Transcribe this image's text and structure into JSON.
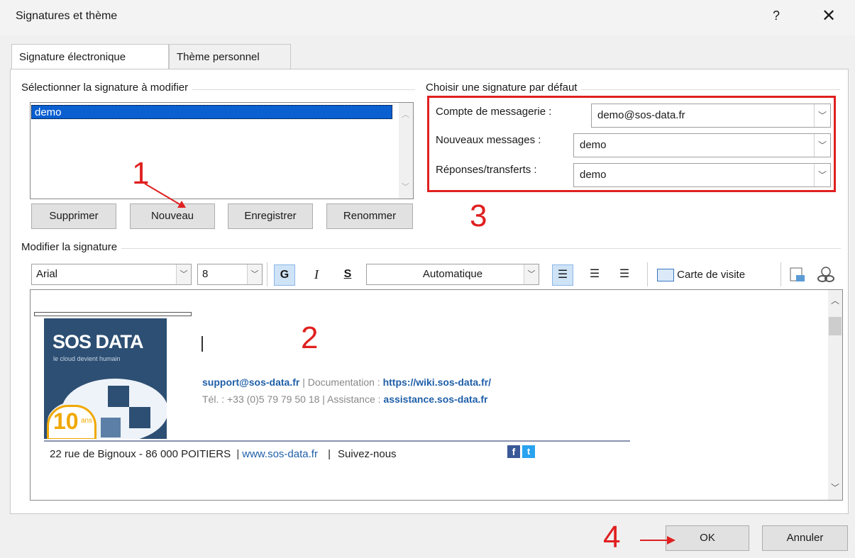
{
  "window": {
    "title": "Signatures et thème",
    "help_label": "?",
    "close_label": "✕"
  },
  "tabs": [
    {
      "label": "Signature électronique"
    },
    {
      "label": "Thème personnel"
    }
  ],
  "select_group": {
    "label": "Sélectionner la signature à modifier",
    "items": [
      "demo"
    ]
  },
  "buttons": {
    "delete": "Supprimer",
    "new": "Nouveau",
    "save": "Enregistrer",
    "rename": "Renommer",
    "ok": "OK",
    "cancel": "Annuler"
  },
  "default_group": {
    "label": "Choisir une signature par défaut",
    "account_label": "Compte de messagerie :",
    "account_value": "demo@sos-data.fr",
    "new_messages_label": "Nouveaux messages :",
    "new_messages_value": "demo",
    "replies_label": "Réponses/transferts :",
    "replies_value": "demo"
  },
  "edit_group": {
    "label": "Modifier la signature",
    "font": "Arial",
    "size": "8",
    "bold": "G",
    "italic": "I",
    "underline": "S",
    "color": "Automatique",
    "business_card": "Carte de visite"
  },
  "signature": {
    "logo_title": "SOS DATA",
    "logo_tagline": "le cloud devient humain",
    "logo_years": "10",
    "logo_years_unit": "ans",
    "email": "support@sos-data.fr",
    "sep1": " | Documentation : ",
    "doc_url": "https://wiki.sos-data.fr/",
    "phone": "Tél. : +33 (0)5 79 79 50 18",
    "sep2": " | Assistance : ",
    "assist_url": "assistance.sos-data.fr",
    "address": "22 rue de Bignoux  - 86 000 POITIERS",
    "site_url": "www.sos-data.fr",
    "follow": "Suivez-nous"
  },
  "annotations": {
    "a1": "1",
    "a2": "2",
    "a3": "3",
    "a4": "4"
  },
  "colors": {
    "annotation": "#e02020",
    "selection": "#0a5fd1",
    "link": "#1f5fa8",
    "logo_bg": "#2d4f73"
  }
}
